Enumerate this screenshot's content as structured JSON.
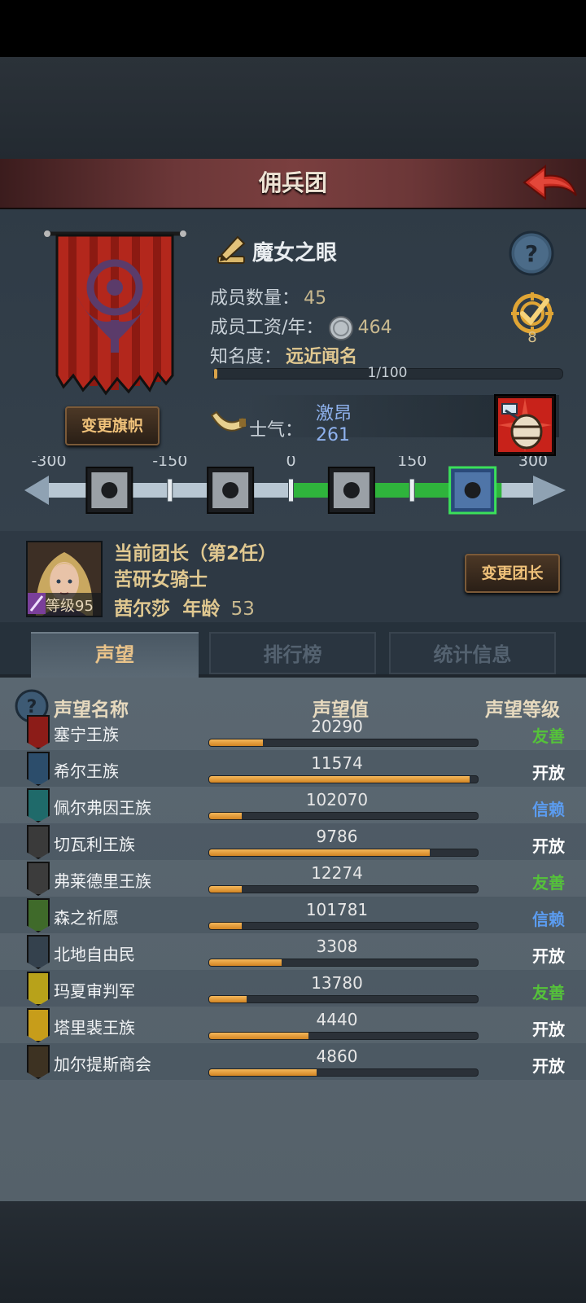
{
  "header": {
    "title": "佣兵团"
  },
  "team": {
    "name": "魔女之眼",
    "member_count_label": "成员数量：",
    "member_count": "45",
    "salary_label": "成员工资/年：",
    "salary": "464",
    "fame_label": "知名度：",
    "fame_value": "远近闻名",
    "fame_progress": "1/100",
    "fame_fraction": 0.01,
    "target_count": "8",
    "change_banner_label": "变更旗帜"
  },
  "morale": {
    "label": "士气：",
    "state": "激昂",
    "value": "261",
    "scale_ticks": [
      "-300",
      "-150",
      "0",
      "150",
      "300"
    ],
    "scale_min": -300,
    "scale_max": 300,
    "current": 261
  },
  "commander": {
    "title": "当前团长（第2任）",
    "class": "苦研女骑士",
    "name": "茜尔莎",
    "age_label": "年龄",
    "age": "53",
    "level_label": "等级",
    "level": "95",
    "change_label": "变更团长"
  },
  "tabs": {
    "reputation": "声望",
    "ranking": "排行榜",
    "stats": "统计信息"
  },
  "table": {
    "col_name": "声望名称",
    "col_value": "声望值",
    "col_level": "声望等级",
    "rows": [
      {
        "name": "塞宁王族",
        "value": "20290",
        "fill": 0.2,
        "level": "友善",
        "level_color": "#55c23a",
        "icon_color": "#8c1c18"
      },
      {
        "name": "希尔王族",
        "value": "11574",
        "fill": 0.97,
        "level": "开放",
        "level_color": "#ffffff",
        "icon_color": "#2c4d6b"
      },
      {
        "name": "佩尔弗因王族",
        "value": "102070",
        "fill": 0.12,
        "level": "信赖",
        "level_color": "#5b9cf0",
        "icon_color": "#1f6a6a"
      },
      {
        "name": "切瓦利王族",
        "value": "9786",
        "fill": 0.82,
        "level": "开放",
        "level_color": "#ffffff",
        "icon_color": "#3a3a3a"
      },
      {
        "name": "弗莱德里王族",
        "value": "12274",
        "fill": 0.12,
        "level": "友善",
        "level_color": "#55c23a",
        "icon_color": "#3c3c3c"
      },
      {
        "name": "森之祈愿",
        "value": "101781",
        "fill": 0.12,
        "level": "信赖",
        "level_color": "#5b9cf0",
        "icon_color": "#3f6a2a"
      },
      {
        "name": "北地自由民",
        "value": "3308",
        "fill": 0.27,
        "level": "开放",
        "level_color": "#ffffff",
        "icon_color": "#34414d"
      },
      {
        "name": "玛夏审判军",
        "value": "13780",
        "fill": 0.14,
        "level": "友善",
        "level_color": "#55c23a",
        "icon_color": "#b8a21a"
      },
      {
        "name": "塔里裴王族",
        "value": "4440",
        "fill": 0.37,
        "level": "开放",
        "level_color": "#ffffff",
        "icon_color": "#c79d1a"
      },
      {
        "name": "加尔提斯商会",
        "value": "4860",
        "fill": 0.4,
        "level": "开放",
        "level_color": "#ffffff",
        "icon_color": "#3d3222"
      }
    ]
  }
}
